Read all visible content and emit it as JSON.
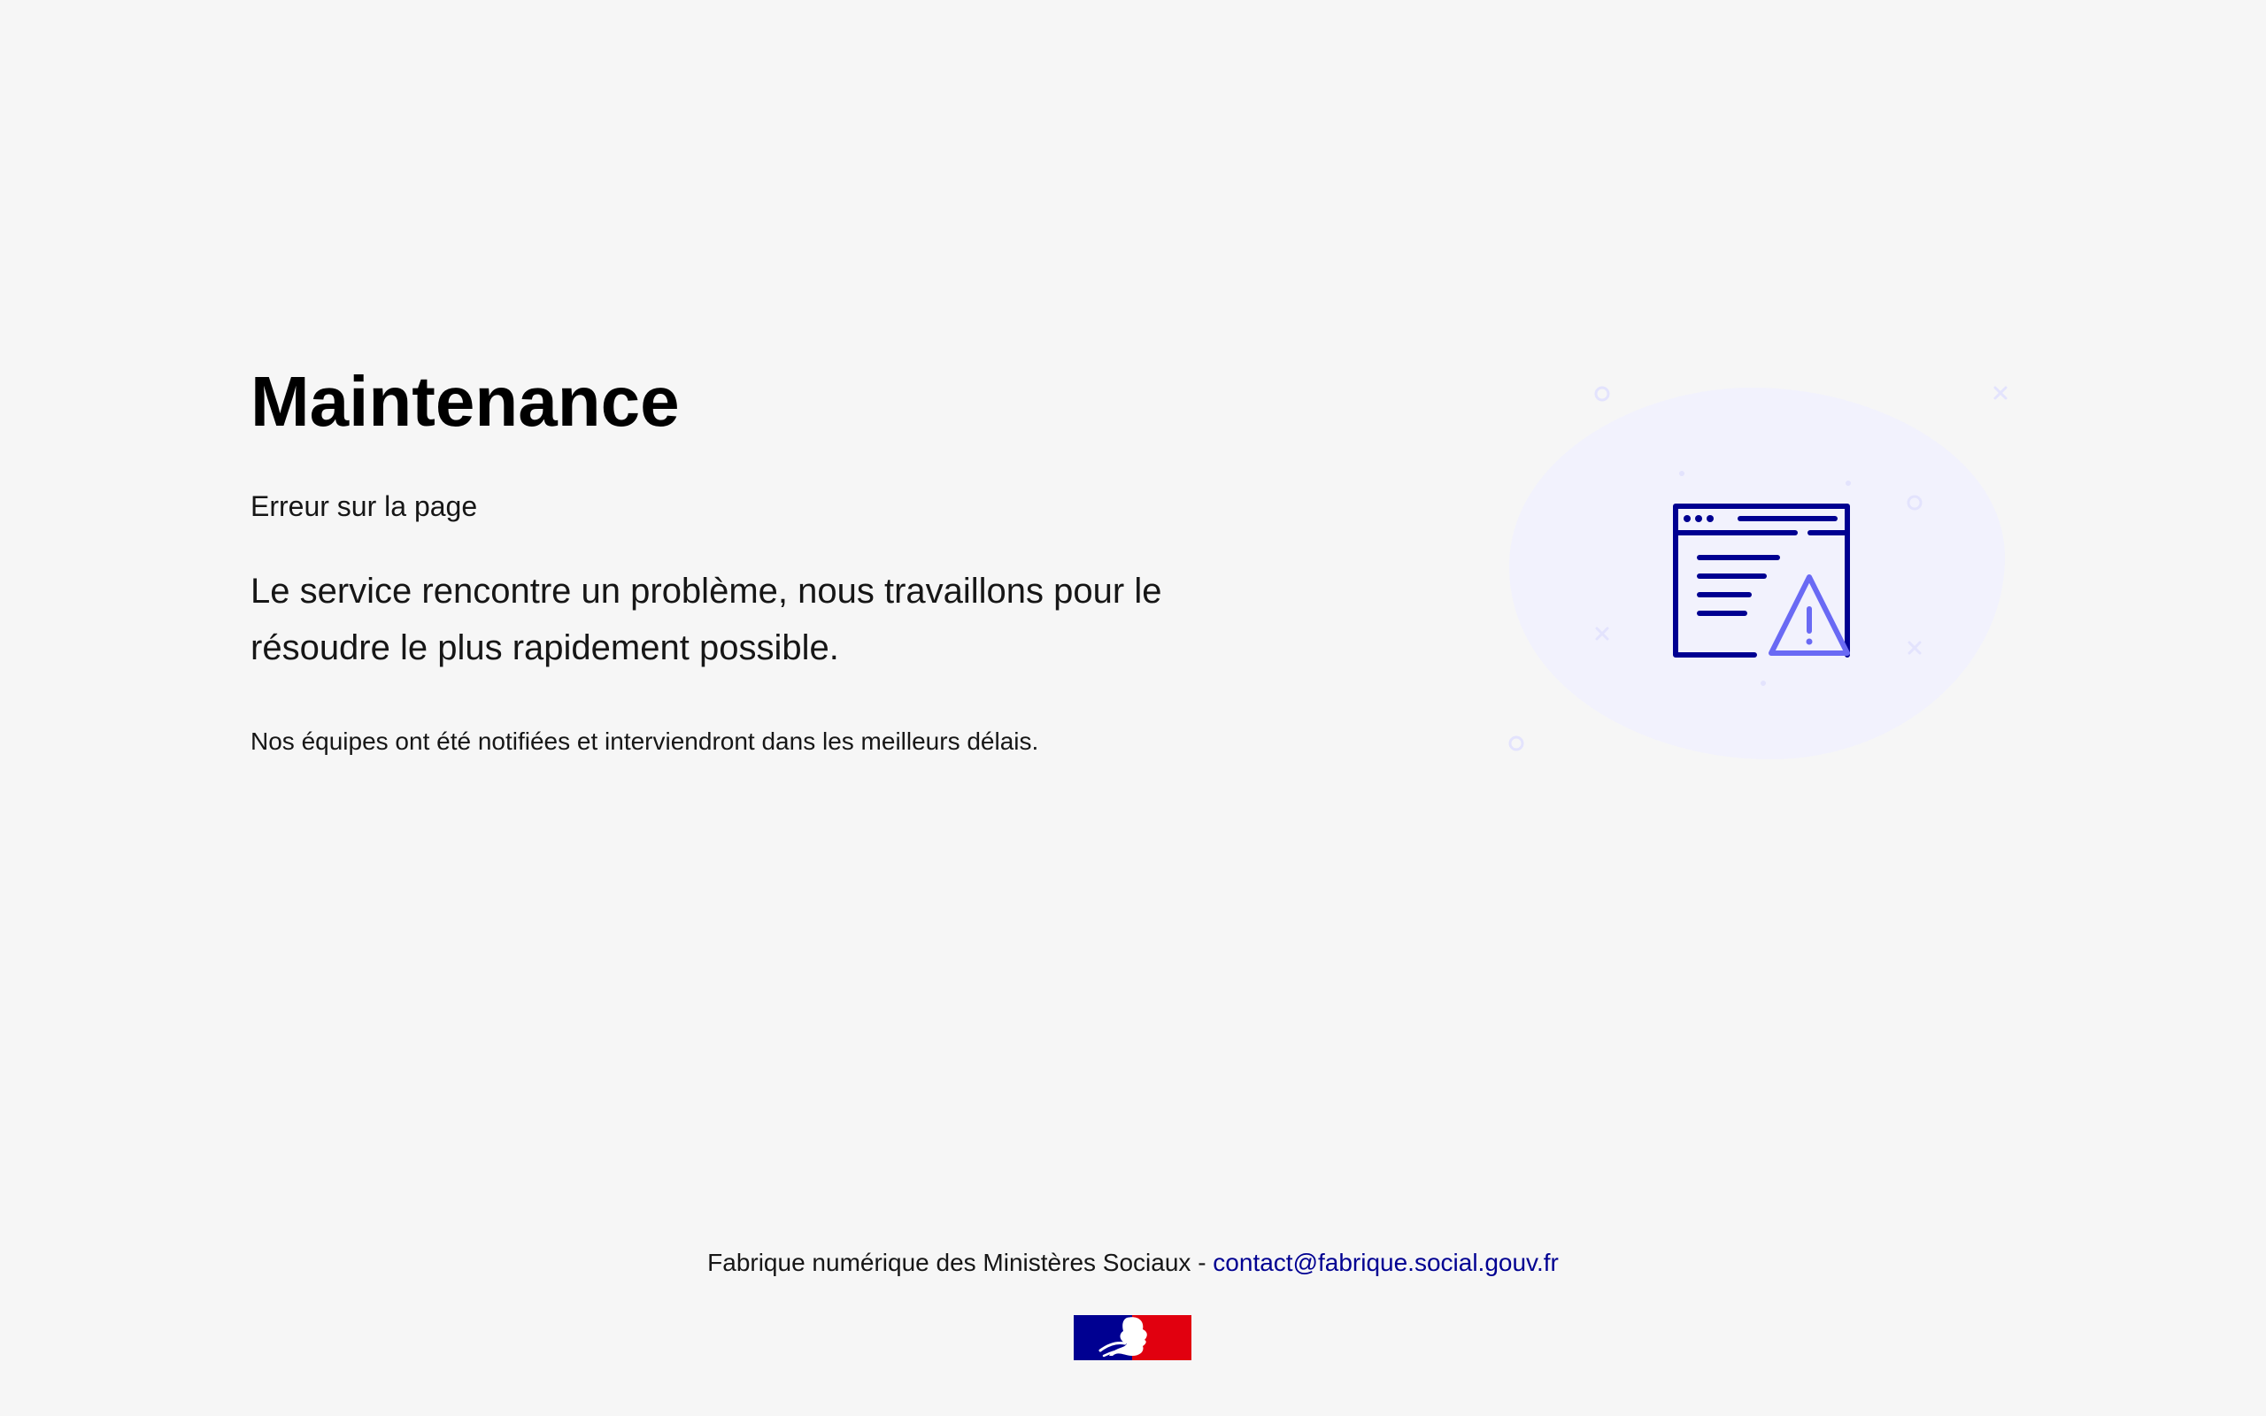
{
  "main": {
    "title": "Maintenance",
    "subtitle": "Erreur sur la page",
    "lead": "Le service rencontre un problème, nous travaillons pour le résoudre le plus rapidement possible.",
    "note": "Nos équipes ont été notifiées et interviendront dans les meilleurs délais."
  },
  "illustration": {
    "icon": "technical-error-icon"
  },
  "footer": {
    "text": "Fabrique numérique des Ministères Sociaux - ",
    "contact_link": "contact@fabrique.social.gouv.fr"
  },
  "logo": {
    "icon": "marianne-logo-icon"
  },
  "colors": {
    "background": "#f6f6f6",
    "text": "#161616",
    "link": "#000091",
    "icon_primary": "#000091",
    "icon_accent": "#6a6af4",
    "blob": "#f2f2fd",
    "flag_blue": "#000091",
    "flag_red": "#e1000f"
  }
}
